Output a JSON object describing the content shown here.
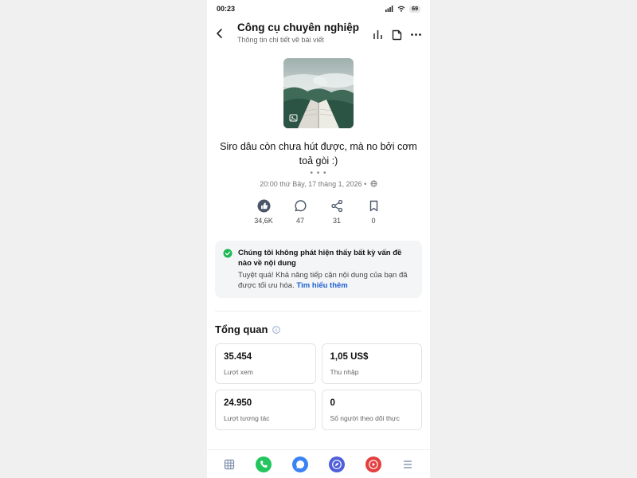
{
  "status_bar": {
    "time": "00:23",
    "battery": "69"
  },
  "header": {
    "title": "Công cụ chuyên nghiệp",
    "subtitle": "Thông tin chi tiết về bài viết"
  },
  "post": {
    "caption": "Siro dâu còn chưa hút được, mà no bởi cơm toả gòi :)",
    "dots": "• • •",
    "timestamp": "20:00 thứ Bảy, 17 tháng 1, 2026 •"
  },
  "stats": [
    {
      "icon": "like-icon",
      "value": "34,6K"
    },
    {
      "icon": "comment-icon",
      "value": "47"
    },
    {
      "icon": "share-icon",
      "value": "31"
    },
    {
      "icon": "bookmark-icon",
      "value": "0"
    }
  ],
  "notice": {
    "title": "Chúng tôi không phát hiện thấy bất kỳ vấn đề nào về nội dung",
    "body": "Tuyệt quá! Khả năng tiếp cận nội dung của bạn đã được tối ưu hóa.",
    "link": "Tìm hiểu thêm"
  },
  "overview": {
    "title": "Tổng quan",
    "cards": [
      {
        "value": "35.454",
        "label": "Lượt xem"
      },
      {
        "value": "1,05 US$",
        "label": "Thu nhập"
      },
      {
        "value": "24.950",
        "label": "Lượt tương tác"
      },
      {
        "value": "0",
        "label": "Số người theo dõi thực"
      }
    ]
  },
  "colors": {
    "accent_green": "#1db954",
    "link_blue": "#1a5fd0",
    "nav_phone": "#22c55e",
    "nav_chat": "#3b82f6",
    "nav_compass": "#4f5fd8",
    "nav_video": "#e53e3e"
  },
  "bottom_nav": [
    "apps-icon",
    "phone-icon",
    "chat-icon",
    "compass-icon",
    "video-icon",
    "menu-icon"
  ]
}
